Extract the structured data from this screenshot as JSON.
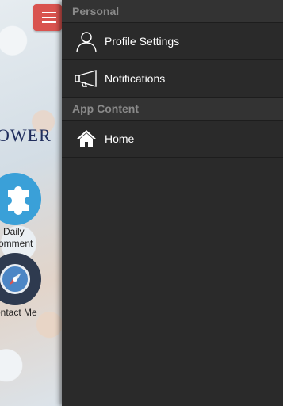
{
  "background": {
    "brand_text": "OWER",
    "shortcuts": [
      {
        "icon": "puzzle-icon",
        "label_line1": "Daily",
        "label_line2": "omment"
      },
      {
        "icon": "compass-icon",
        "label_line1": "ontact Me"
      }
    ]
  },
  "drawer": {
    "sections": [
      {
        "title": "Personal",
        "items": [
          {
            "label": "Profile Settings",
            "icon": "user-icon"
          },
          {
            "label": "Notifications",
            "icon": "megaphone-icon"
          }
        ]
      },
      {
        "title": "App Content",
        "items": [
          {
            "label": "Home",
            "icon": "home-icon"
          }
        ]
      }
    ]
  },
  "colors": {
    "drawer_bg": "#2a2a2a",
    "header_text": "#8a8a8a",
    "menu_button": "#d9534f"
  }
}
